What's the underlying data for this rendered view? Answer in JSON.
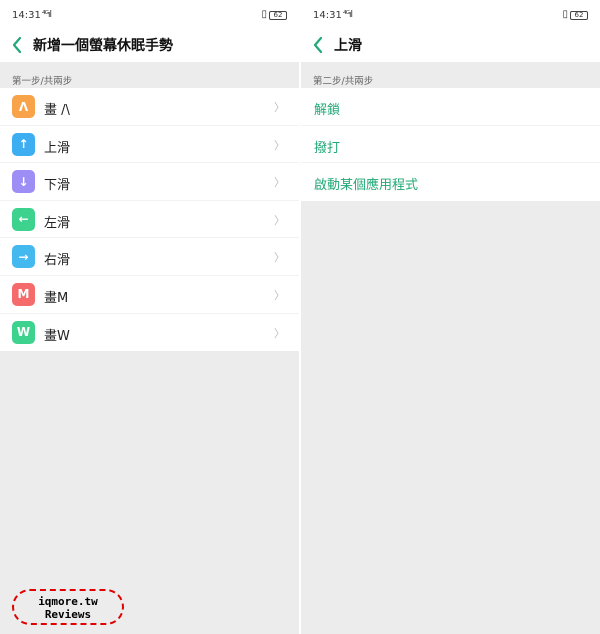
{
  "colors": {
    "accent": "#21a877",
    "background": "#ececec"
  },
  "left": {
    "status": {
      "time": "14:31",
      "signal": "⁴ᴳıl",
      "vibrate": "▯",
      "battery": "62"
    },
    "nav": {
      "back_icon": "chevron-left-icon",
      "title": "新增一個螢幕休眠手勢"
    },
    "section_label": "第一步/共兩步",
    "items": [
      {
        "label": "畫 /\\",
        "glyph": "Λ",
        "color": "#f8a24a",
        "icon": "gesture-caret-icon"
      },
      {
        "label": "上滑",
        "glyph": "↑",
        "color": "#3daef2",
        "icon": "arrow-up-icon"
      },
      {
        "label": "下滑",
        "glyph": "↓",
        "color": "#9c8ef5",
        "icon": "arrow-down-icon"
      },
      {
        "label": "左滑",
        "glyph": "←",
        "color": "#3ed28f",
        "icon": "arrow-left-icon"
      },
      {
        "label": "右滑",
        "glyph": "→",
        "color": "#44b9f0",
        "icon": "arrow-right-icon"
      },
      {
        "label": "畫M",
        "glyph": "M",
        "color": "#f56a6a",
        "icon": "gesture-m-icon"
      },
      {
        "label": "畫W",
        "glyph": "W",
        "color": "#3ed28f",
        "icon": "gesture-w-icon"
      }
    ],
    "chevron": "〉"
  },
  "right": {
    "status": {
      "time": "14:31",
      "signal": "⁴ᴳıl",
      "vibrate": "▯",
      "battery": "62"
    },
    "nav": {
      "back_icon": "chevron-left-icon",
      "title": "上滑"
    },
    "section_label": "第二步/共兩步",
    "actions": [
      {
        "label": "解鎖"
      },
      {
        "label": "撥打"
      },
      {
        "label": "啟動某個應用程式"
      }
    ]
  },
  "watermark": {
    "line1": "iqmore.tw",
    "line2": "Reviews"
  }
}
